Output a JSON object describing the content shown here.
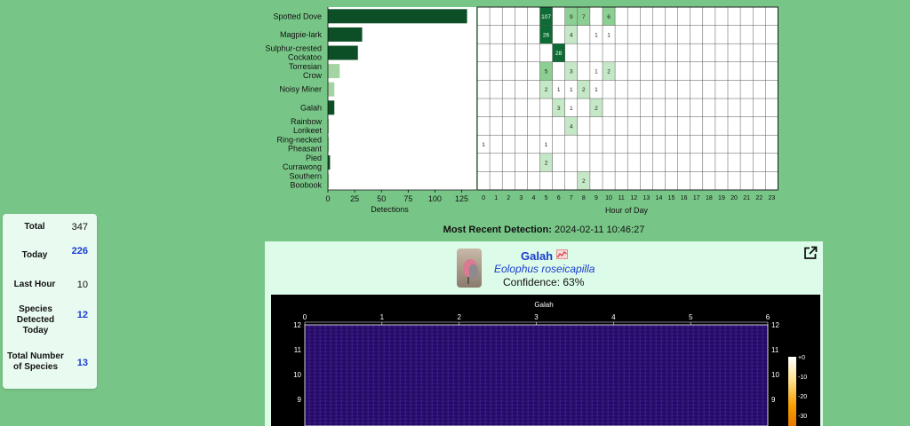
{
  "stats": {
    "total_label": "Total",
    "total_value": "347",
    "today_label": "Today",
    "today_value": "226",
    "last_hour_label": "Last Hour",
    "last_hour_value": "10",
    "species_today_label": "Species Detected Today",
    "species_today_value": "12",
    "total_species_label": "Total Number of Species",
    "total_species_value": "13"
  },
  "chart_data": {
    "type": "bar",
    "xlabel": "Detections",
    "xticks": [
      0,
      25,
      50,
      75,
      100,
      125
    ],
    "xlim": [
      0,
      137
    ],
    "categories": [
      "Spotted Dove",
      "Magpie-lark",
      "Sulphur-crested Cockatoo",
      "Torresian Crow",
      "Noisy Miner",
      "Galah",
      "Rainbow Lorikeet",
      "Ring-necked Pheasant",
      "Pied Currawong",
      "Southern Boobook"
    ],
    "values": [
      130,
      32,
      28,
      11,
      6,
      6,
      1,
      1,
      2,
      1
    ],
    "colors": [
      "#0c4e25",
      "#0c4e25",
      "#0c4e25",
      "#a5d4a4",
      "#a5d4a4",
      "#0c4e25",
      "#a5d4a4",
      "#a5d4a4",
      "#0c4e25",
      "#a5d4a4"
    ],
    "heatmap": {
      "xlabel": "Hour of Day",
      "hours": [
        0,
        1,
        2,
        3,
        4,
        5,
        6,
        7,
        8,
        9,
        10,
        11,
        12,
        13,
        14,
        15,
        16,
        17,
        18,
        19,
        20,
        21,
        22,
        23
      ],
      "cells": [
        {
          "row": 0,
          "hour": 5,
          "value": 107
        },
        {
          "row": 0,
          "hour": 7,
          "value": 9
        },
        {
          "row": 0,
          "hour": 8,
          "value": 7
        },
        {
          "row": 0,
          "hour": 10,
          "value": 6
        },
        {
          "row": 1,
          "hour": 5,
          "value": 26
        },
        {
          "row": 1,
          "hour": 7,
          "value": 4
        },
        {
          "row": 1,
          "hour": 9,
          "value": 1
        },
        {
          "row": 1,
          "hour": 10,
          "value": 1
        },
        {
          "row": 2,
          "hour": 6,
          "value": 28
        },
        {
          "row": 3,
          "hour": 5,
          "value": 5
        },
        {
          "row": 3,
          "hour": 7,
          "value": 3
        },
        {
          "row": 3,
          "hour": 9,
          "value": 1
        },
        {
          "row": 3,
          "hour": 10,
          "value": 2
        },
        {
          "row": 4,
          "hour": 5,
          "value": 2
        },
        {
          "row": 4,
          "hour": 6,
          "value": 1
        },
        {
          "row": 4,
          "hour": 7,
          "value": 1
        },
        {
          "row": 4,
          "hour": 8,
          "value": 2
        },
        {
          "row": 4,
          "hour": 9,
          "value": 1
        },
        {
          "row": 5,
          "hour": 6,
          "value": 3
        },
        {
          "row": 5,
          "hour": 7,
          "value": 1
        },
        {
          "row": 5,
          "hour": 9,
          "value": 2
        },
        {
          "row": 6,
          "hour": 7,
          "value": 4
        },
        {
          "row": 7,
          "hour": 0,
          "value": 1
        },
        {
          "row": 7,
          "hour": 5,
          "value": 1
        },
        {
          "row": 8,
          "hour": 5,
          "value": 2
        },
        {
          "row": 9,
          "hour": 8,
          "value": 2
        }
      ]
    }
  },
  "recent": {
    "heading_label": "Most Recent Detection:",
    "timestamp": "2024-02-11 10:46:27",
    "common_name": "Galah",
    "scientific_name": "Eolophus roseicapilla",
    "confidence": "Confidence: 63%",
    "spectrogram": {
      "title": "Galah",
      "x_ticks": [
        "0",
        "1",
        "2",
        "3",
        "4",
        "5",
        "6"
      ],
      "y_ticks": [
        "12",
        "11",
        "10",
        "9"
      ],
      "colorbar_ticks": [
        "+0",
        "-10",
        "-20",
        "-30"
      ]
    }
  }
}
